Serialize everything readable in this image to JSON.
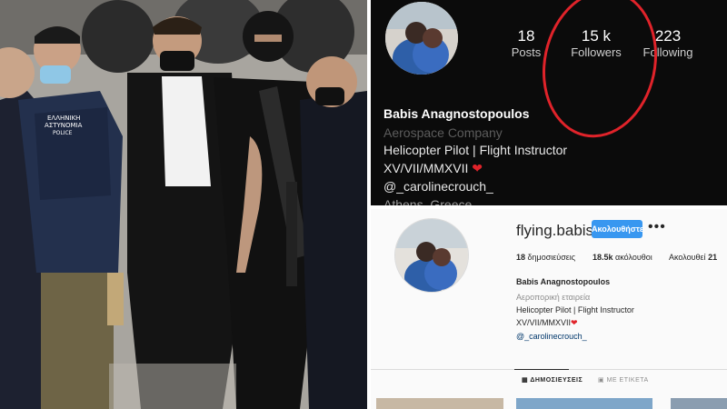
{
  "dark_profile": {
    "posts": {
      "value": "18",
      "label": "Posts"
    },
    "followers": {
      "value": "15 k",
      "label": "Followers"
    },
    "following": {
      "value": "223",
      "label": "Following"
    },
    "name": "Babis Anagnostopoulos",
    "category": "Aerospace Company",
    "bio": [
      "Helicopter Pilot | Flight Instructor",
      "XV/VII/MMXVII"
    ],
    "mention": "@_carolinecrouch_",
    "location": "Athens, Greece",
    "highlight_color": "#e0232a"
  },
  "light_profile": {
    "username": "flying.babis",
    "follow_label": "Ακολουθήστε",
    "more_label": "•••",
    "posts": {
      "value": "18",
      "label": "δημοσιεύσεις"
    },
    "followers": {
      "value": "18.5k",
      "label": "ακόλουθοι"
    },
    "following": {
      "label": "Ακολουθεί",
      "value": "21"
    },
    "name": "Babis Anagnostopoulos",
    "category": "Αεροπορική εταιρεία",
    "bio": [
      "Helicopter Pilot | Flight Instructor",
      "XV/VII/MMXVII"
    ],
    "mention": "@_carolinecrouch_",
    "tabs": [
      {
        "icon": "grid-icon",
        "label": "ΔΗΜΟΣΙΕΥΣΕΙΣ"
      },
      {
        "icon": "tag-icon",
        "label": "ΜΕ ΕΤΙΚΕΤΑ"
      }
    ],
    "accent_color": "#3897f0"
  },
  "photo": {
    "vest_text": [
      "ΕΛΛΗΝΙΚΗ",
      "ΑΣΤΥΝΟΜΙΑ",
      "POLICE"
    ]
  }
}
